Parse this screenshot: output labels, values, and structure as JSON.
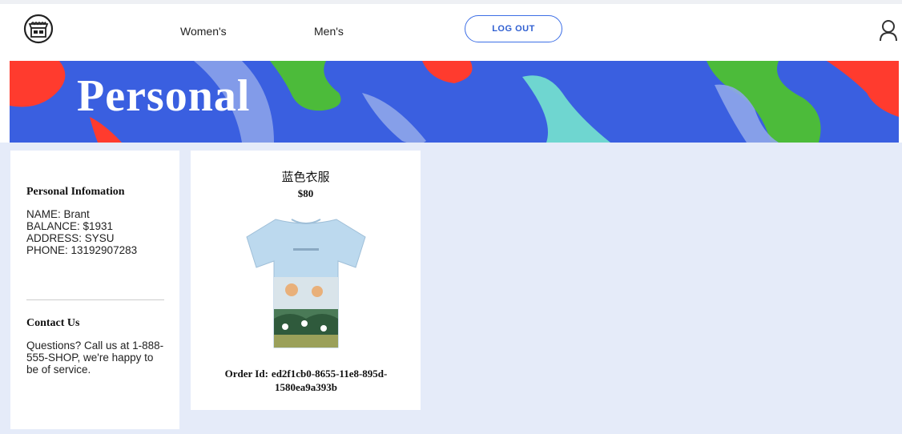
{
  "nav": {
    "links": [
      {
        "label": "Women's"
      },
      {
        "label": "Men's"
      }
    ],
    "logout_label": "LOG OUT"
  },
  "banner": {
    "title": "Personal"
  },
  "sidebar": {
    "info_heading": "Personal Infomation",
    "name": "NAME: Brant",
    "balance": "BALANCE: $1931",
    "address": "ADDRESS: SYSU",
    "phone": "PHONE: 13192907283",
    "contact_heading": "Contact Us",
    "contact_text": "Questions? Call us at 1-888-555-SHOP, we're happy to be of service."
  },
  "orders": [
    {
      "name": "蓝色衣服",
      "price": "$80",
      "order_id_label": "Order Id:",
      "order_id": "ed2f1cb0-8655-11e8-895d-1580ea9a393b"
    }
  ],
  "colors": {
    "banner_blue": "#3a5fe0",
    "accent_red": "#ff3b2e",
    "accent_green": "#4cbb3a",
    "accent_teal": "#6fd6d0",
    "page_bg": "#e5ebf9",
    "logout_border": "#3d6fe6"
  },
  "icons": {
    "logo": "store-logo-icon",
    "user": "user-icon"
  }
}
